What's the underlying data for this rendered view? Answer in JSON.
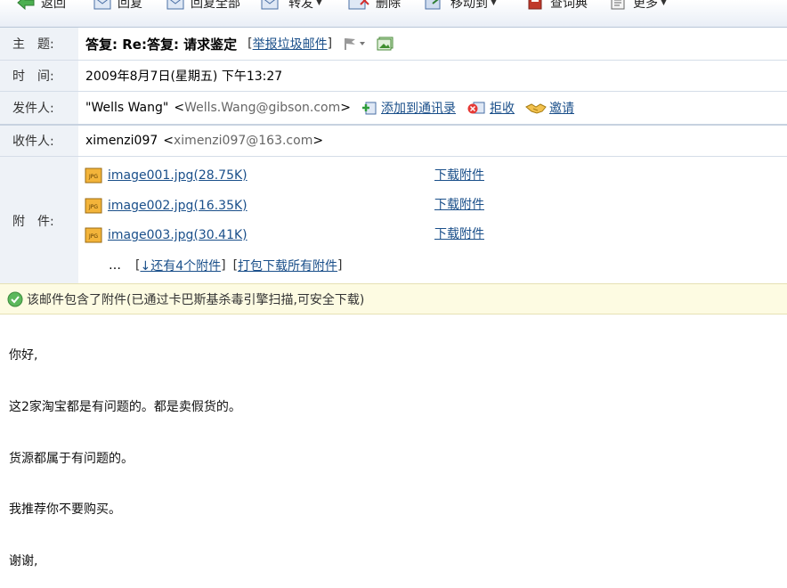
{
  "toolbar": {
    "items": [
      {
        "label": "返回",
        "icon": "back-arrow-icon"
      },
      {
        "label": "回复",
        "icon": "reply-icon"
      },
      {
        "label": "回复全部",
        "icon": "reply-all-icon"
      },
      {
        "label": "转发",
        "icon": "forward-icon"
      },
      {
        "label": "删除",
        "icon": "delete-icon"
      },
      {
        "label": "移动到",
        "icon": "move-icon"
      },
      {
        "label": "查词典",
        "icon": "dictionary-icon"
      },
      {
        "label": "更多",
        "icon": "more-icon"
      }
    ]
  },
  "header": {
    "subject_label": "主　题:",
    "subject": "答复: Re:答复: 请求鉴定",
    "report_spam": "举报垃圾邮件",
    "time_label": "时　间:",
    "time": "2009年8月7日(星期五) 下午13:27",
    "sender_label": "发件人:",
    "sender_name": "\"Wells Wang\"",
    "sender_email": "Wells.Wang@gibson.com",
    "add_contact": "添加到通讯录",
    "reject": "拒收",
    "invite": "邀请",
    "recipient_label": "收件人:",
    "recipient_name": "ximenzi097",
    "recipient_email": "ximenzi097@163.com"
  },
  "attachments": {
    "label": "附　件:",
    "files": [
      {
        "name": "image001.jpg(28.75K)",
        "download": "下载附件"
      },
      {
        "name": "image002.jpg(16.35K)",
        "download": "下载附件"
      },
      {
        "name": "image003.jpg(30.41K)",
        "download": "下载附件"
      }
    ],
    "ellipsis": "…",
    "more": "↓还有4个附件",
    "download_all": "打包下载所有附件"
  },
  "scan_notice": "该邮件包含了附件(已通过卡巴斯基杀毒引擎扫描,可安全下载)",
  "body": {
    "lines": [
      "你好,",
      "这2家淘宝都是有问题的。都是卖假货的。",
      "货源都属于有问题的。",
      "我推荐你不要购买。",
      "谢谢,"
    ]
  },
  "colors": {
    "link": "#1a4f8a",
    "label_bg": "#eef2f7",
    "notice_bg": "#fdfbe2"
  }
}
